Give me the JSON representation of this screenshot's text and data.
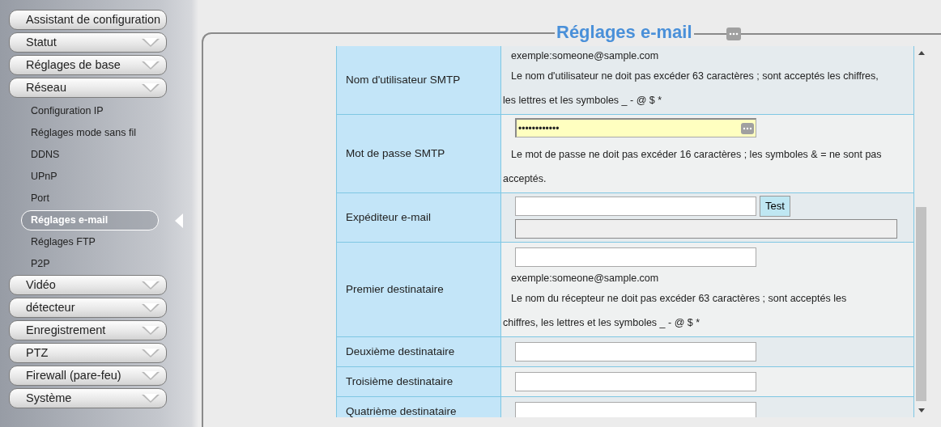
{
  "sidebar": {
    "items": [
      {
        "label": "Assistant de configuration",
        "expandable": false
      },
      {
        "label": "Statut",
        "expandable": true
      },
      {
        "label": "Réglages de base",
        "expandable": true
      },
      {
        "label": "Réseau",
        "expandable": true,
        "children": [
          {
            "label": "Configuration IP",
            "selected": false
          },
          {
            "label": "Réglages mode sans fil",
            "selected": false
          },
          {
            "label": "DDNS",
            "selected": false
          },
          {
            "label": "UPnP",
            "selected": false
          },
          {
            "label": "Port",
            "selected": false
          },
          {
            "label": "Réglages e-mail",
            "selected": true
          },
          {
            "label": "Réglages FTP",
            "selected": false
          },
          {
            "label": "P2P",
            "selected": false
          }
        ]
      },
      {
        "label": "Vidéo",
        "expandable": true
      },
      {
        "label": "détecteur",
        "expandable": true
      },
      {
        "label": "Enregistrement",
        "expandable": true
      },
      {
        "label": "PTZ",
        "expandable": true
      },
      {
        "label": "Firewall (pare-feu)",
        "expandable": true
      },
      {
        "label": "Système",
        "expandable": true
      }
    ]
  },
  "panel": {
    "title": "Réglages e-mail",
    "rows": [
      {
        "label": "Nom d'utilisateur SMTP",
        "parts": [
          {
            "kind": "example",
            "text": "exemple:someone@sample.com"
          },
          {
            "kind": "note",
            "text": "Le nom d'utilisateur ne doit pas excéder 63 caractères ; sont acceptés les chiffres, les lettres et les symboles _ - @ $ *"
          }
        ]
      },
      {
        "label": "Mot de passe SMTP",
        "parts": [
          {
            "kind": "password",
            "value": "••••••••••••"
          },
          {
            "kind": "note",
            "text": "Le mot de passe ne doit pas excéder 16 caractères ; les symboles & = ne sont pas acceptés."
          }
        ]
      },
      {
        "label": "Expéditeur e-mail",
        "parts": [
          {
            "kind": "input_button",
            "button": "Test"
          },
          {
            "kind": "result"
          }
        ]
      },
      {
        "label": "Premier destinataire",
        "parts": [
          {
            "kind": "input"
          },
          {
            "kind": "example",
            "text": "exemple:someone@sample.com"
          },
          {
            "kind": "note",
            "text": "Le nom du récepteur ne doit pas excéder 63 caractères ; sont acceptés les chiffres, les lettres et les symboles _ - @ $ *"
          }
        ]
      },
      {
        "label": "Deuxième destinataire",
        "parts": [
          {
            "kind": "input"
          }
        ]
      },
      {
        "label": "Troisième destinataire",
        "parts": [
          {
            "kind": "input"
          }
        ]
      },
      {
        "label": "Quatrième destinataire",
        "parts": [
          {
            "kind": "input"
          }
        ]
      }
    ]
  }
}
